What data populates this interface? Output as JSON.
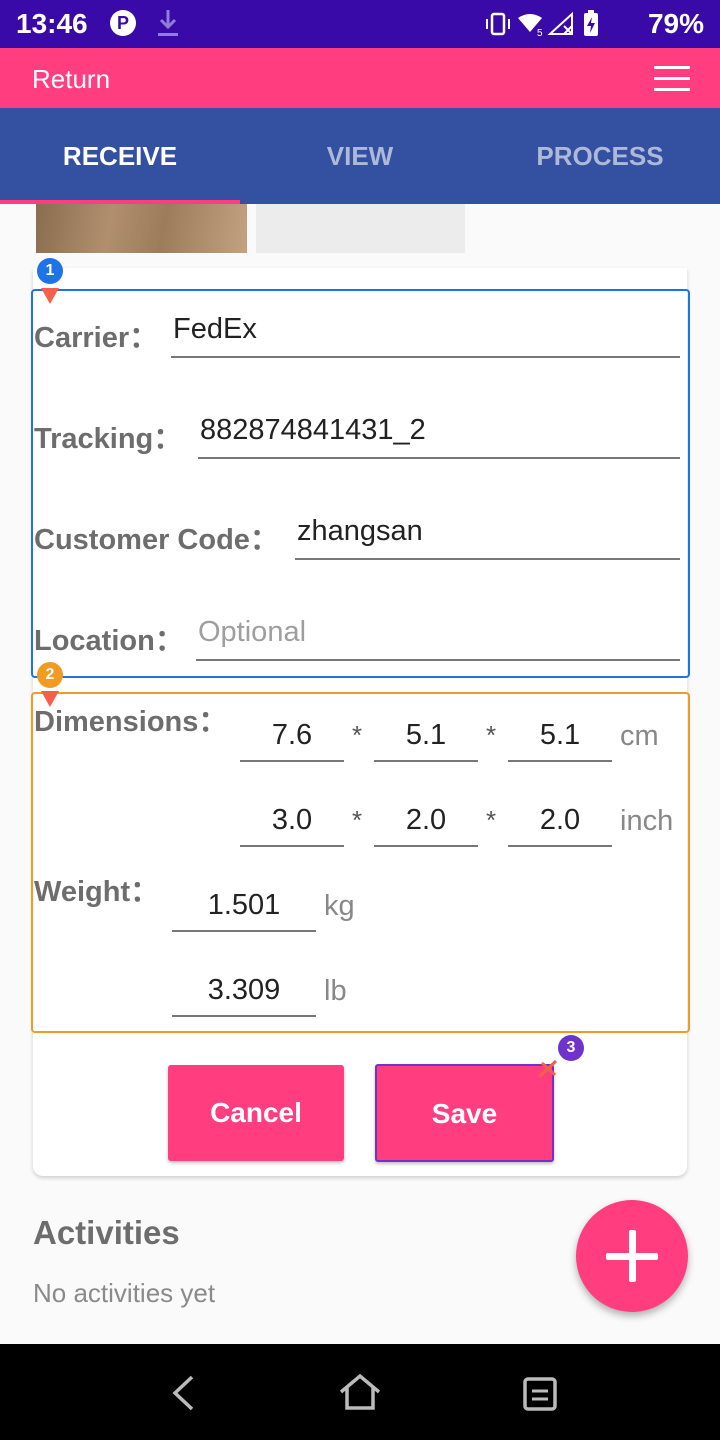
{
  "status_bar": {
    "time": "13:46",
    "p_icon": "P",
    "battery": "79%",
    "icons": [
      "download-icon",
      "vibrate-icon",
      "wifi-icon",
      "signal-icon",
      "battery-charging-icon"
    ]
  },
  "app_bar": {
    "title": "Return",
    "menu_icon": "menu-icon"
  },
  "tabs": [
    {
      "label": "RECEIVE",
      "active": true
    },
    {
      "label": "VIEW",
      "active": false
    },
    {
      "label": "PROCESS",
      "active": false
    }
  ],
  "form": {
    "carrier": {
      "label": "Carrier：",
      "value": "FedEx"
    },
    "tracking": {
      "label": "Tracking：",
      "value": "882874841431_2"
    },
    "customer_code": {
      "label": "Customer Code：",
      "value": "zhangsan"
    },
    "location": {
      "label": "Location：",
      "value": "",
      "placeholder": "Optional"
    },
    "dimensions": {
      "label": "Dimensions：",
      "separator": "*",
      "cm": {
        "values": [
          "7.6",
          "5.1",
          "5.1"
        ],
        "unit": "cm"
      },
      "inch": {
        "values": [
          "3.0",
          "2.0",
          "2.0"
        ],
        "unit": "inch"
      }
    },
    "weight": {
      "label": "Weight：",
      "kg": {
        "value": "1.501",
        "unit": "kg"
      },
      "lb": {
        "value": "3.309",
        "unit": "lb"
      }
    }
  },
  "annotations": {
    "badge1": "1",
    "badge2": "2",
    "badge3": "3"
  },
  "buttons": {
    "cancel": "Cancel",
    "save": "Save"
  },
  "activities": {
    "title": "Activities",
    "empty": "No activities yet"
  },
  "colors": {
    "status_bar": "#3a0aa8",
    "accent": "#ff3d7f",
    "tab_bar": "#3450a0"
  }
}
